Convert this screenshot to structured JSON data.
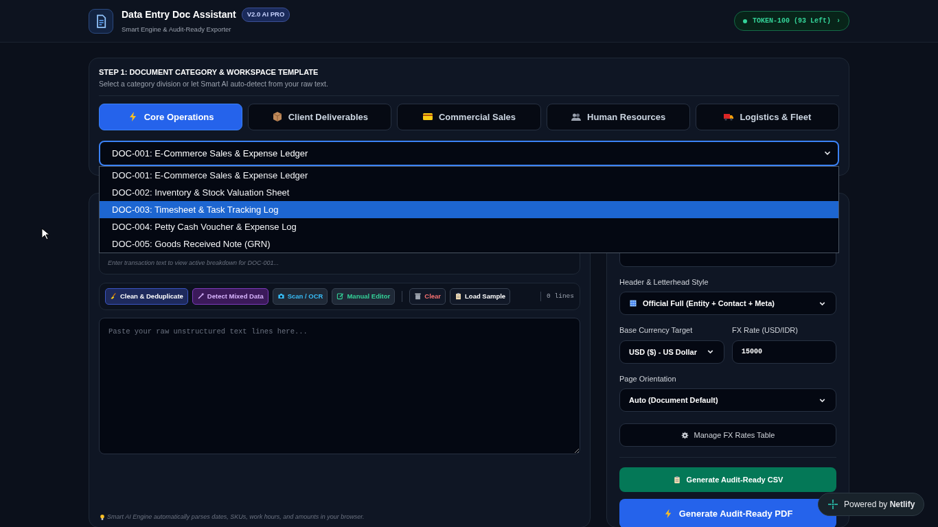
{
  "header": {
    "title": "Data Entry Doc Assistant",
    "version_badge": "V2.0 AI PRO",
    "subtitle": "Smart Engine & Audit-Ready Exporter",
    "token": "TOKEN-100 (93 Left)",
    "token_chevron": "›"
  },
  "step1": {
    "title": "STEP 1: DOCUMENT CATEGORY & WORKSPACE TEMPLATE",
    "subtitle": "Select a category division or let Smart AI auto-detect from your raw text.",
    "tabs": [
      {
        "label": "Core Operations",
        "selected": true
      },
      {
        "label": "Client Deliverables",
        "selected": false
      },
      {
        "label": "Commercial Sales",
        "selected": false
      },
      {
        "label": "Human Resources",
        "selected": false
      },
      {
        "label": "Logistics & Fleet",
        "selected": false
      }
    ],
    "template_select": {
      "value": "DOC-001: E-Commerce Sales & Expense Ledger",
      "expanded": true
    },
    "options": [
      {
        "label": "DOC-001: E-Commerce Sales & Expense Ledger",
        "selected": false
      },
      {
        "label": "DOC-002: Inventory & Stock Valuation Sheet",
        "selected": false
      },
      {
        "label": "DOC-003: Timesheet & Task Tracking Log",
        "selected": true
      },
      {
        "label": "DOC-004: Petty Cash Voucher & Expense Log",
        "selected": false
      },
      {
        "label": "DOC-005: Goods Received Note (GRN)",
        "selected": false
      }
    ]
  },
  "editor": {
    "breakdown_hint": "Enter transaction text to view active breakdown for DOC-001...",
    "toolbar": [
      {
        "label": "Clean & Deduplicate",
        "kind": "clean"
      },
      {
        "label": "Detect Mixed Data",
        "kind": "detect"
      },
      {
        "label": "Scan / OCR",
        "kind": "scan"
      },
      {
        "label": "Manual Editor",
        "kind": "editor"
      },
      {
        "label": "Clear",
        "kind": "clear"
      },
      {
        "label": "Load Sample",
        "kind": "sample"
      }
    ],
    "line_count": "0 lines",
    "placeholder": "Paste your raw unstructured text lines here...",
    "footer_note": "Smart AI Engine automatically parses dates, SKUs, work hours, and amounts in your browser."
  },
  "settings": {
    "header_style": {
      "label": "Header & Letterhead Style",
      "value": "Official Full (Entity + Contact + Meta)"
    },
    "currency": {
      "label": "Base Currency Target",
      "value": "USD ($) - US Dollar"
    },
    "fx_rate": {
      "label": "FX Rate (USD/IDR)",
      "value": "15000"
    },
    "orientation": {
      "label": "Page Orientation",
      "value": "Auto (Document Default)"
    },
    "fx_button": "Manage FX Rates Table",
    "csv_button": "Generate Audit-Ready CSV",
    "pdf_button": "Generate Audit-Ready PDF"
  },
  "netlify_badge": {
    "prefix": "Powered by ",
    "brand": "Netlify"
  }
}
